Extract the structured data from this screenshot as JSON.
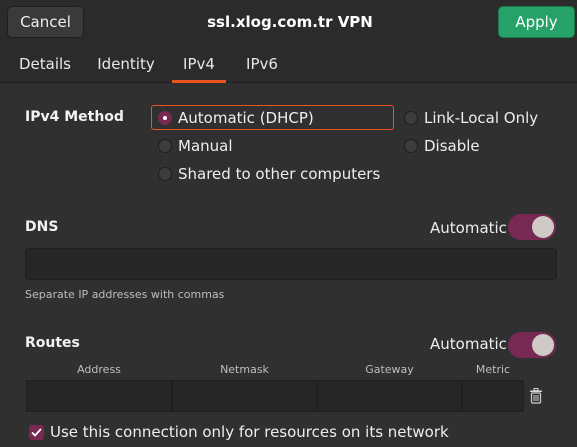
{
  "header": {
    "cancel_label": "Cancel",
    "title": "ssl.xlog.com.tr VPN",
    "apply_label": "Apply"
  },
  "tabs": [
    {
      "label": "Details",
      "active": false
    },
    {
      "label": "Identity",
      "active": false
    },
    {
      "label": "IPv4",
      "active": true
    },
    {
      "label": "IPv6",
      "active": false
    }
  ],
  "ipv4": {
    "method_label": "IPv4 Method",
    "options": [
      {
        "label": "Automatic (DHCP)",
        "checked": true
      },
      {
        "label": "Link-Local Only",
        "checked": false
      },
      {
        "label": "Manual",
        "checked": false
      },
      {
        "label": "Disable",
        "checked": false
      },
      {
        "label": "Shared to other computers",
        "checked": false
      }
    ]
  },
  "dns": {
    "label": "DNS",
    "automatic_label": "Automatic",
    "automatic_on": true,
    "value": "",
    "hint": "Separate IP addresses with commas"
  },
  "routes": {
    "label": "Routes",
    "automatic_label": "Automatic",
    "automatic_on": true,
    "columns": [
      "Address",
      "Netmask",
      "Gateway",
      "Metric"
    ]
  },
  "only_resources": {
    "label": "Use this connection only for resources on its network",
    "checked": true
  },
  "colors": {
    "accent": "#e95420",
    "toggle_on": "#772953",
    "apply_green": "#26a269"
  },
  "icons": {
    "trash": "trash-icon",
    "check": "checkmark-icon"
  }
}
